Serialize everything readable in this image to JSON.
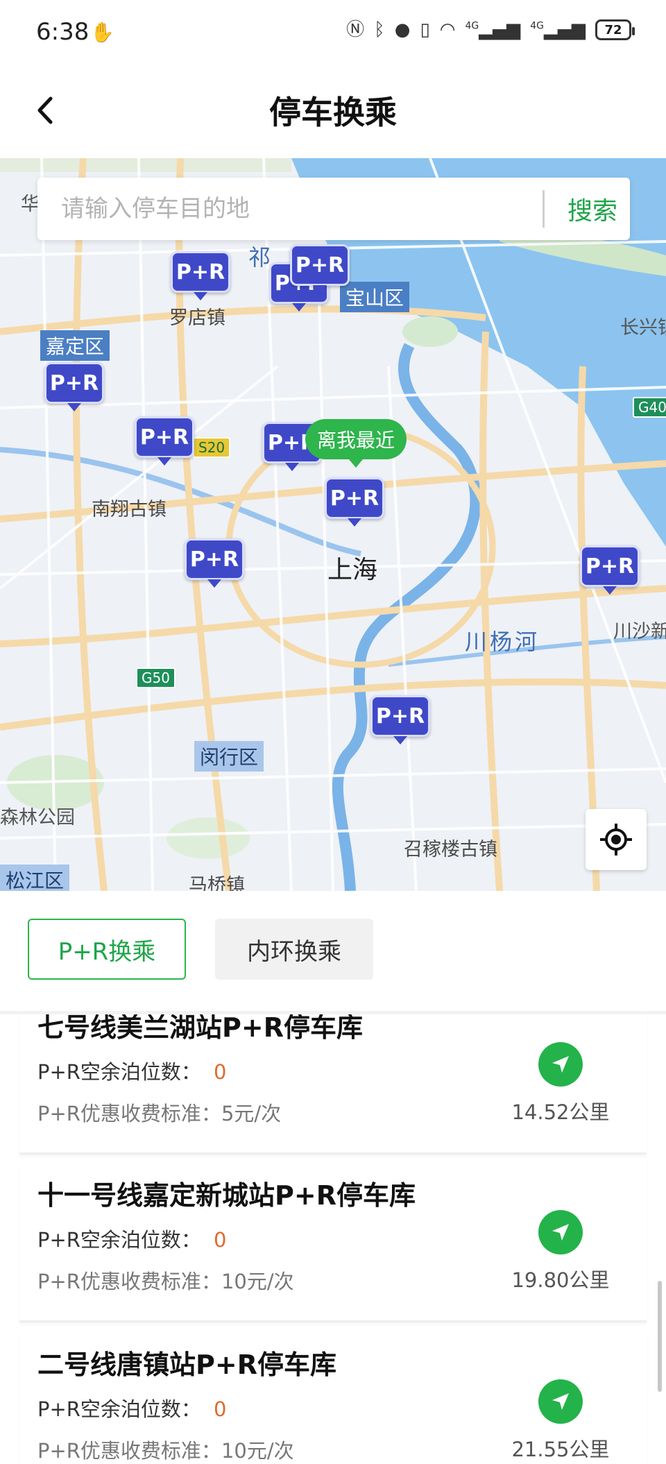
{
  "status_bar": {
    "time": "6:38",
    "network_1": "4G",
    "network_2": "4G",
    "battery": "72"
  },
  "header": {
    "title": "停车换乘"
  },
  "search": {
    "placeholder": "请输入停车目的地",
    "button_label": "搜索"
  },
  "map": {
    "nearest_label": "离我最近",
    "marker_label": "P+R",
    "labels": {
      "city": "上海",
      "luodian": "罗店镇",
      "baoshan": "宝山区",
      "jiading": "嘉定区",
      "nanxiang": "南翔古镇",
      "minhang": "闵行区",
      "chuanyanghe": "川杨河",
      "chuansha": "川沙新",
      "zhaojialou": "召稼楼古镇",
      "senlin": "森林公园",
      "songjiang": "松江区",
      "maqiao": "马桥镇",
      "changxing": "长兴镇",
      "hua": "华",
      "qi": "祁"
    },
    "roads": {
      "s20": "S20",
      "g50": "G50",
      "g40": "G40"
    }
  },
  "tabs": [
    {
      "label": "P+R换乘",
      "active": true
    },
    {
      "label": "内环换乘",
      "active": false
    }
  ],
  "list": {
    "spaces_label": "P+R空余泊位数：",
    "price_label": "P+R优惠收费标准：",
    "items": [
      {
        "title": "七号线美兰湖站P+R停车库",
        "spaces": "0",
        "price": "5元/次",
        "distance": "14.52公里"
      },
      {
        "title": "十一号线嘉定新城站P+R停车库",
        "spaces": "0",
        "price": "10元/次",
        "distance": "19.80公里"
      },
      {
        "title": "二号线唐镇站P+R停车库",
        "spaces": "0",
        "price": "10元/次",
        "distance": "21.55公里"
      }
    ]
  },
  "colors": {
    "accent_green": "#2eb54c",
    "marker_blue": "#3f49c8",
    "spaces_orange": "#e06a2c"
  }
}
